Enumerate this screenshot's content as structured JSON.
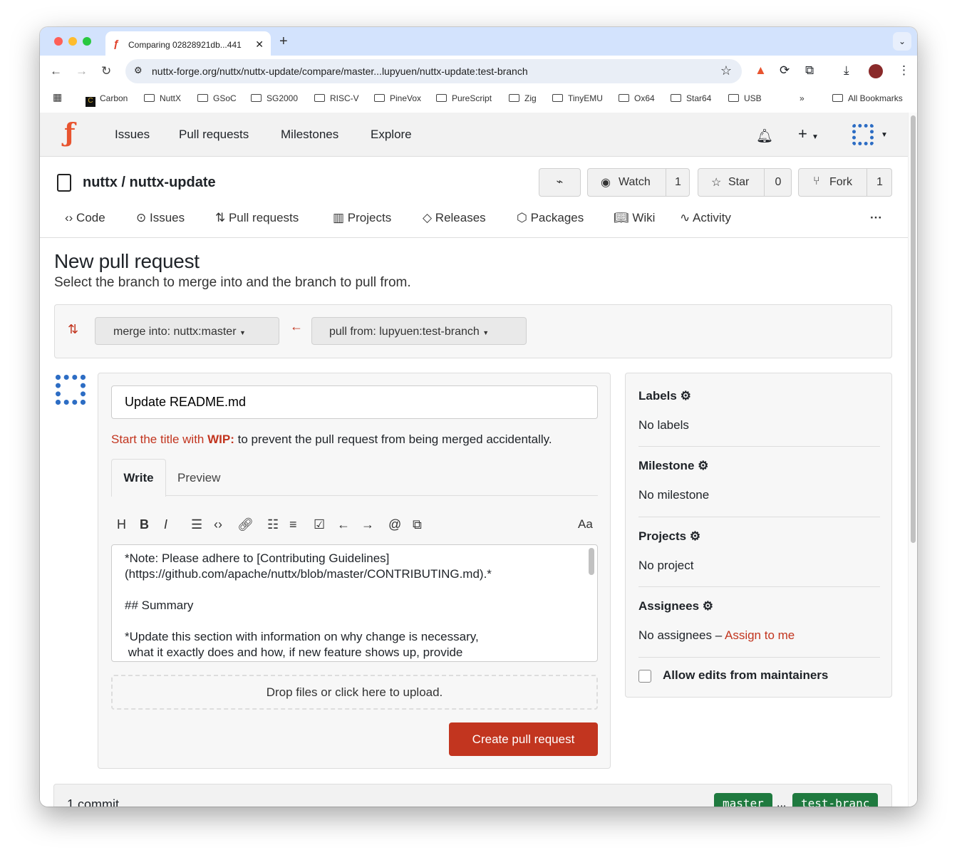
{
  "browser": {
    "tab_title": "Comparing 02828921db...441",
    "url": "nuttx-forge.org/nuttx/nuttx-update/compare/master...lupyuen/nuttx-update:test-branch",
    "bookmarks": [
      "Carbon",
      "NuttX",
      "GSoC",
      "SG2000",
      "RISC-V",
      "PineVox",
      "PureScript",
      "Zig",
      "TinyEMU",
      "Ox64",
      "Star64",
      "USB"
    ],
    "all_bookmarks": "All Bookmarks",
    "overflow": "»"
  },
  "topnav": {
    "items": [
      "Issues",
      "Pull requests",
      "Milestones",
      "Explore"
    ]
  },
  "repo": {
    "title": "nuttx / nuttx-update",
    "watch": "Watch",
    "watch_count": "1",
    "star": "Star",
    "star_count": "0",
    "fork": "Fork",
    "fork_count": "1",
    "tabs": [
      "Code",
      "Issues",
      "Pull requests",
      "Projects",
      "Releases",
      "Packages",
      "Wiki",
      "Activity"
    ]
  },
  "main": {
    "heading": "New pull request",
    "subheading": "Select the branch to merge into and the branch to pull from.",
    "merge_into": "merge into: nuttx:master",
    "pull_from": "pull from: lupyuen:test-branch",
    "title_value": "Update README.md",
    "wip_prefix": "Start the title with ",
    "wip_bold": "WIP:",
    "wip_suffix": " to prevent the pull request from being merged accidentally.",
    "tab_write": "Write",
    "tab_preview": "Preview",
    "font_toggle": "Aa",
    "body_lines": [
      "*Note: Please adhere to [Contributing Guidelines]",
      "(https://github.com/apache/nuttx/blob/master/CONTRIBUTING.md).*",
      "",
      "## Summary",
      "",
      "*Update this section with information on why change is necessary,",
      " what it exactly does and how, if new feature shows up, provide"
    ],
    "drop": "Drop files or click here to upload.",
    "create": "Create pull request"
  },
  "sidebar": {
    "labels": "Labels",
    "no_labels": "No labels",
    "milestone": "Milestone",
    "no_milestone": "No milestone",
    "projects": "Projects",
    "no_project": "No project",
    "assignees": "Assignees",
    "no_assignees": "No assignees –",
    "assign_me": "Assign to me",
    "allow_edits": "Allow edits from maintainers"
  },
  "commits": {
    "count": "1 commit",
    "base": "master",
    "sep": "...",
    "head": "test-branc"
  },
  "colors": {
    "accent": "#c2351f",
    "branch_green": "#1f7a3f"
  }
}
